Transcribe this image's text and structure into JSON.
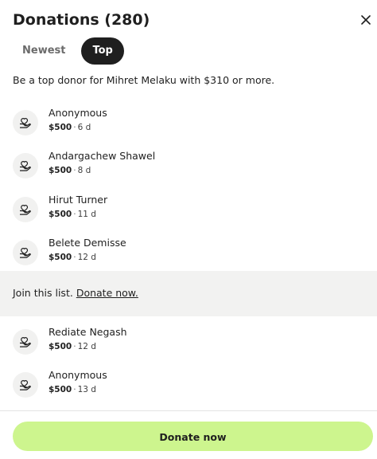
{
  "header": {
    "title": "Donations (280)",
    "close_icon": "close-icon"
  },
  "tabs": [
    {
      "label": "Newest",
      "active": false
    },
    {
      "label": "Top",
      "active": true
    }
  ],
  "subtitle": "Be a top donor for Mihret Melaku with $310 or more.",
  "donors_top": [
    {
      "name": "Anonymous",
      "amount": "$500",
      "time": "6 d"
    },
    {
      "name": "Andargachew Shawel",
      "amount": "$500",
      "time": "8 d"
    },
    {
      "name": "Hirut Turner",
      "amount": "$500",
      "time": "11 d"
    },
    {
      "name": "Belete Demisse",
      "amount": "$500",
      "time": "12 d"
    }
  ],
  "join": {
    "text": "Join this list.",
    "link": "Donate now."
  },
  "donors_bottom": [
    {
      "name": "Rediate Negash",
      "amount": "$500",
      "time": "12 d"
    },
    {
      "name": "Anonymous",
      "amount": "$500",
      "time": "13 d"
    }
  ],
  "meta_separator": "·",
  "donate_button": "Donate now",
  "colors": {
    "accent": "#cdf58e",
    "active_tab": "#1f1f1f",
    "band": "#f2f2f1"
  },
  "icons": {
    "donor_avatar": "heart-in-hand-icon"
  }
}
